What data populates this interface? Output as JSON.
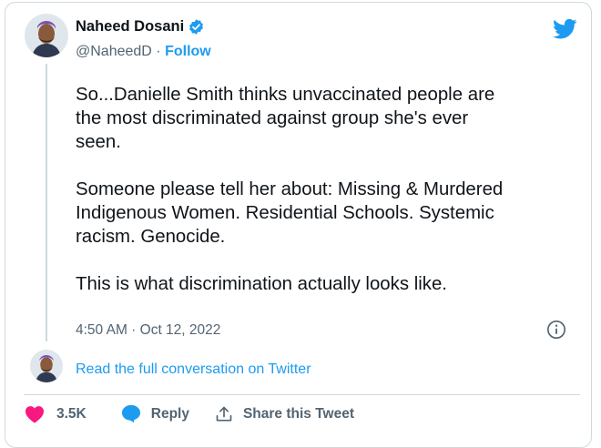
{
  "author": {
    "name": "Naheed Dosani",
    "handle": "@NaheedD",
    "separator": "·",
    "follow_label": "Follow"
  },
  "tweet": {
    "paragraphs": [
      "So...Danielle Smith thinks unvaccinated people are\nthe most discriminated against group she's ever\nseen.",
      "Someone please tell her about: Missing & Murdered\nIndigenous Women. Residential Schools. Systemic\nracism. Genocide.",
      "This is what discrimination actually looks like."
    ],
    "timestamp": "4:50 AM · Oct 12, 2022"
  },
  "conversation_link": "Read the full conversation on Twitter",
  "actions": {
    "like_count": "3.5K",
    "reply_label": "Reply",
    "share_label": "Share this Tweet"
  },
  "icons": {
    "brand": "twitter-bird-icon",
    "verified": "verified-badge-icon",
    "info": "info-icon",
    "like": "heart-icon",
    "reply": "reply-bubble-icon",
    "share": "share-icon"
  },
  "colors": {
    "accent": "#1d9bf0",
    "like": "#f91880",
    "text": "#0f1419",
    "muted": "#536471",
    "border": "#cfd9de"
  }
}
